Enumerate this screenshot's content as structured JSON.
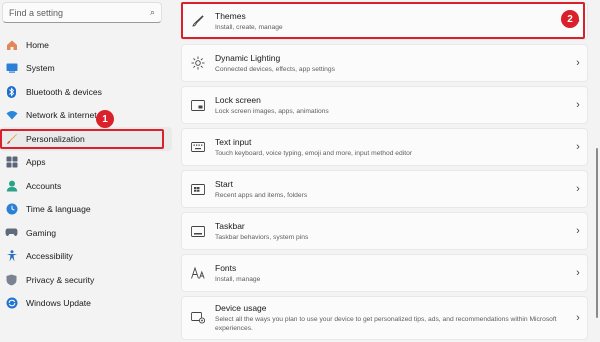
{
  "search": {
    "placeholder": "Find a setting"
  },
  "sidebar": {
    "items": [
      {
        "label": "Home",
        "icon": "home-icon"
      },
      {
        "label": "System",
        "icon": "system-icon"
      },
      {
        "label": "Bluetooth & devices",
        "icon": "bluetooth-icon"
      },
      {
        "label": "Network & internet",
        "icon": "network-icon"
      },
      {
        "label": "Personalization",
        "icon": "brush-icon"
      },
      {
        "label": "Apps",
        "icon": "apps-icon"
      },
      {
        "label": "Accounts",
        "icon": "accounts-icon"
      },
      {
        "label": "Time & language",
        "icon": "clock-icon"
      },
      {
        "label": "Gaming",
        "icon": "gaming-icon"
      },
      {
        "label": "Accessibility",
        "icon": "accessibility-icon"
      },
      {
        "label": "Privacy & security",
        "icon": "shield-icon"
      },
      {
        "label": "Windows Update",
        "icon": "update-icon"
      }
    ],
    "active": "Personalization"
  },
  "main": {
    "items": [
      {
        "title": "Themes",
        "subtitle": "Install, create, manage",
        "icon": "brush-icon"
      },
      {
        "title": "Dynamic Lighting",
        "subtitle": "Connected devices, effects, app settings",
        "icon": "lighting-icon"
      },
      {
        "title": "Lock screen",
        "subtitle": "Lock screen images, apps, animations",
        "icon": "lock-screen-icon"
      },
      {
        "title": "Text input",
        "subtitle": "Touch keyboard, voice typing, emoji and more, input method editor",
        "icon": "keyboard-icon"
      },
      {
        "title": "Start",
        "subtitle": "Recent apps and items, folders",
        "icon": "start-icon"
      },
      {
        "title": "Taskbar",
        "subtitle": "Taskbar behaviors, system pins",
        "icon": "taskbar-icon"
      },
      {
        "title": "Fonts",
        "subtitle": "Install, manage",
        "icon": "fonts-icon"
      },
      {
        "title": "Device usage",
        "subtitle": "Select all the ways you plan to use your device to get personalized tips, ads, and recommendations within Microsoft experiences.",
        "icon": "device-usage-icon"
      }
    ]
  },
  "annotations": {
    "step1": "1",
    "step2": "2"
  },
  "colors": {
    "highlight": "#d9202b",
    "background": "#f3f3f3",
    "card": "#fbfbfb"
  }
}
